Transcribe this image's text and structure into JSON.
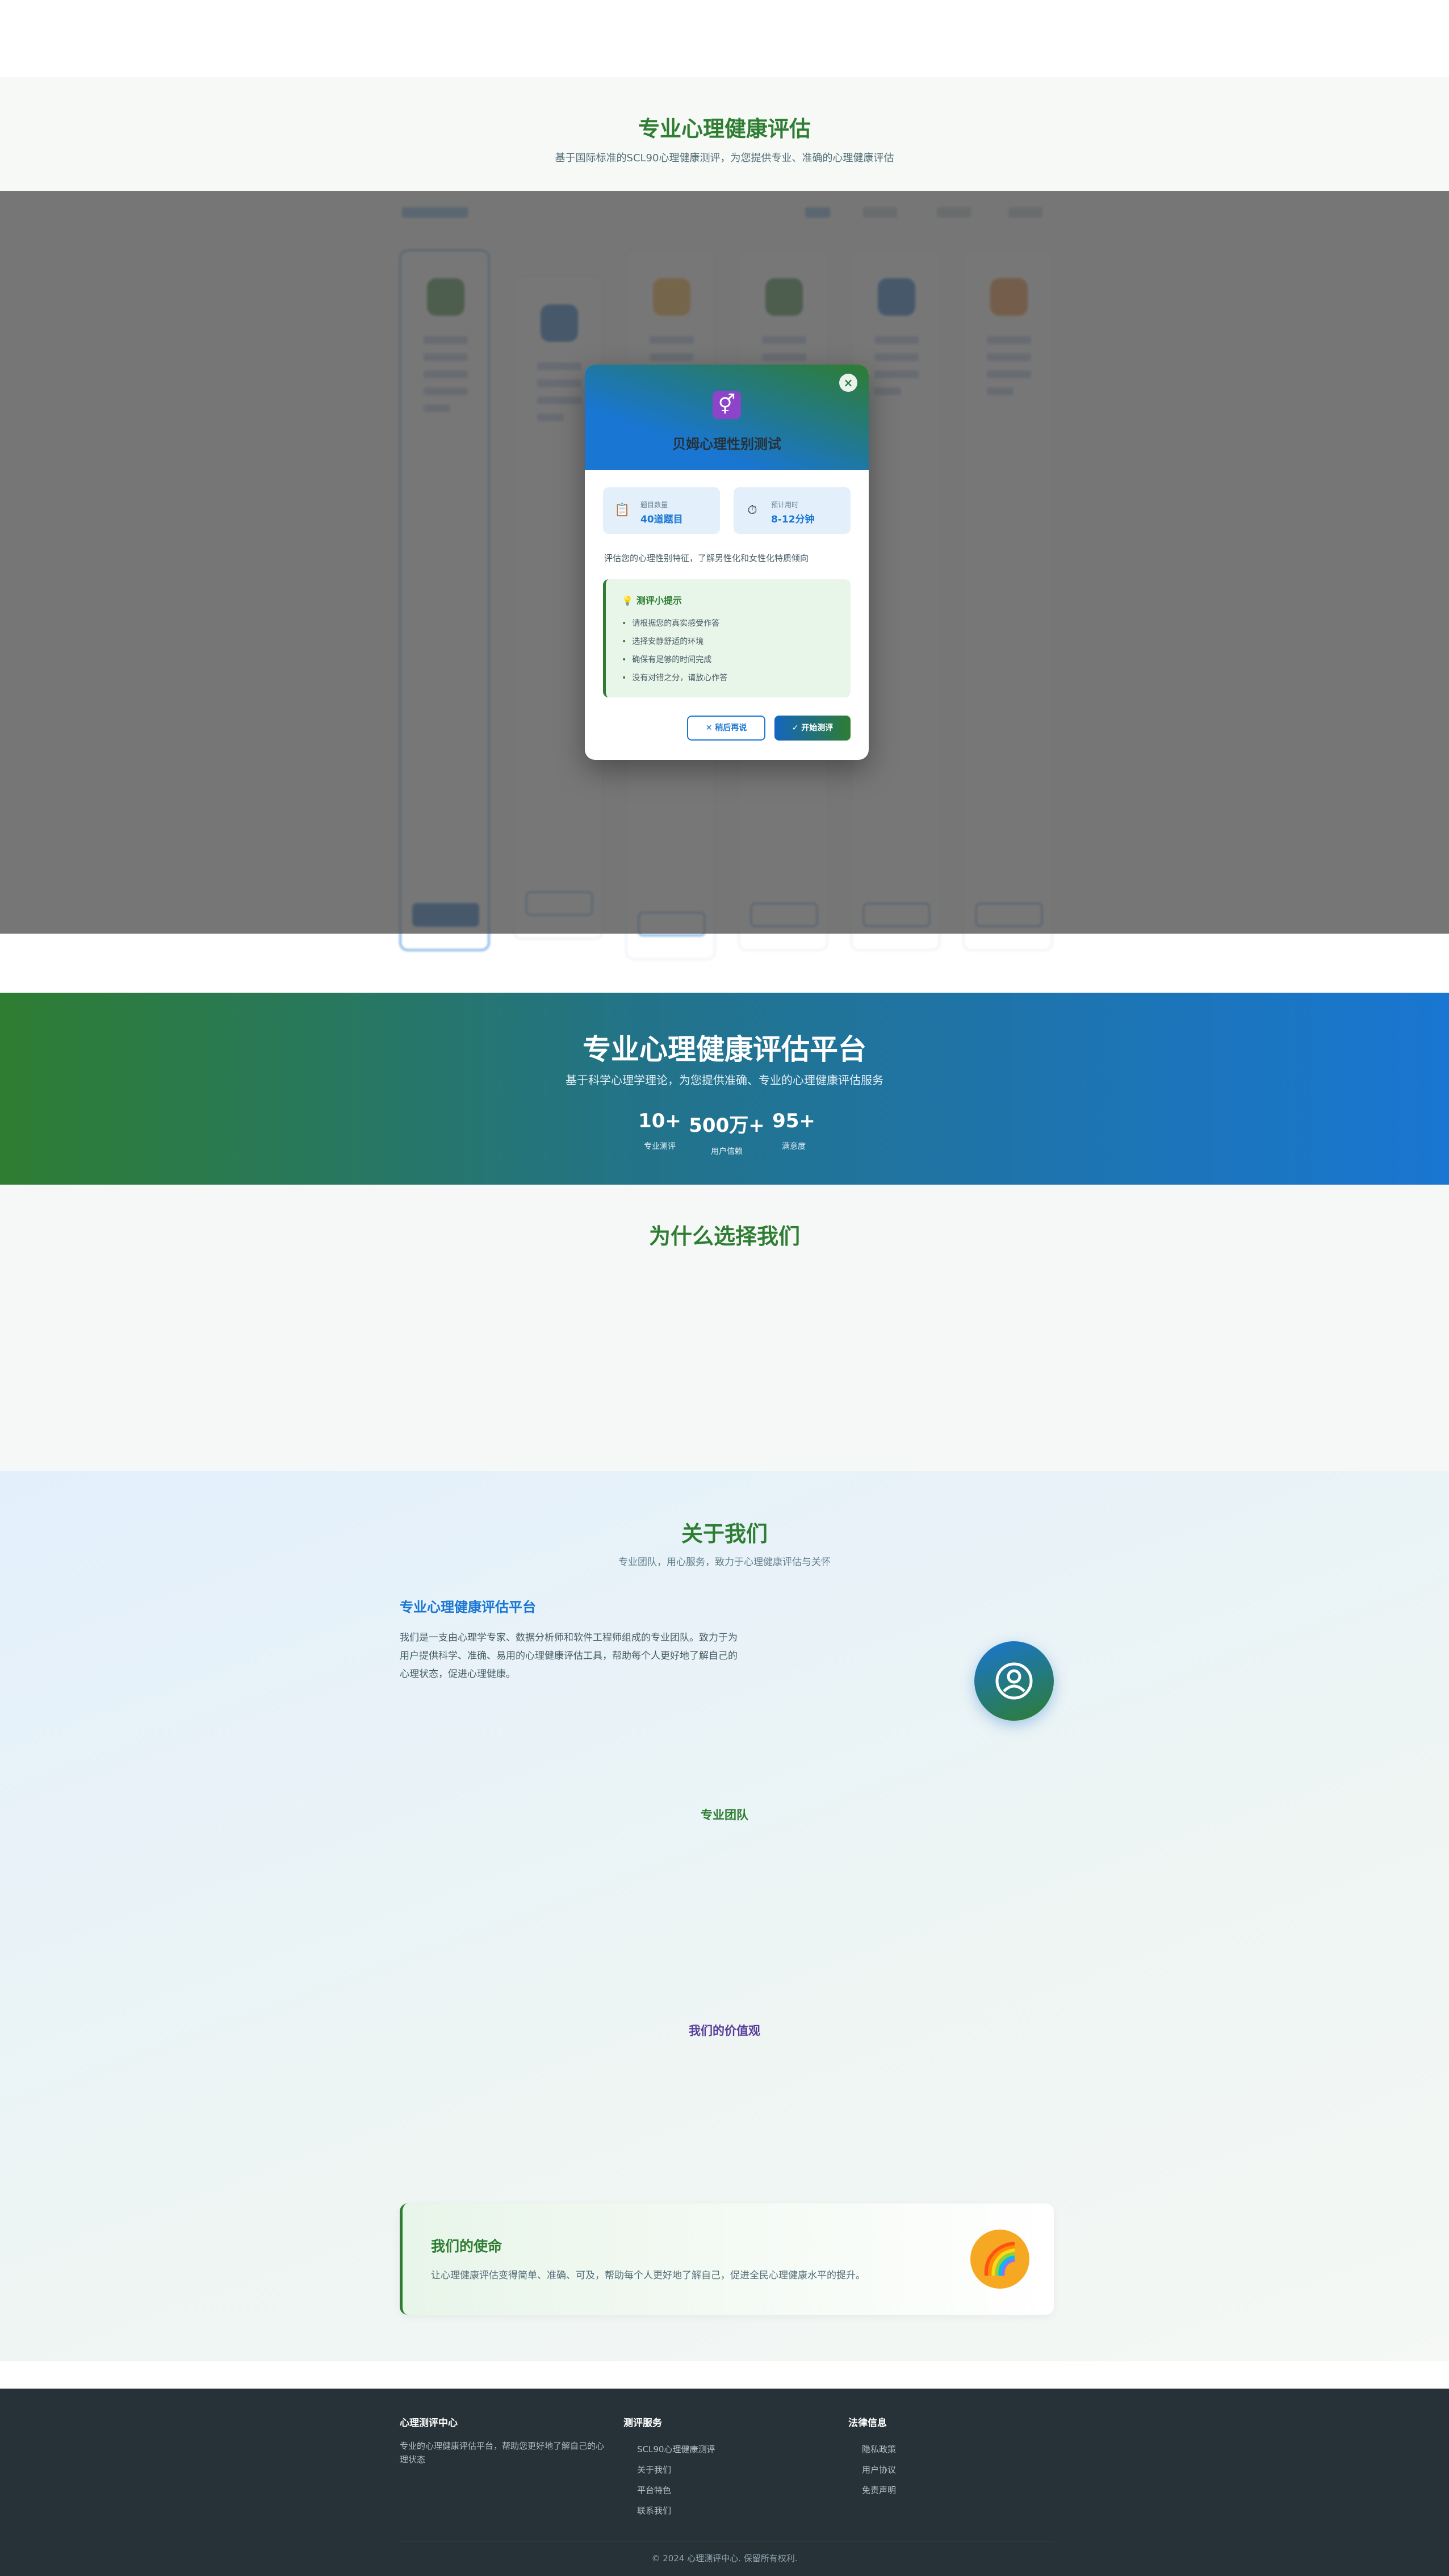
{
  "intro": {
    "title": "专业心理健康评估",
    "subtitle": "基于国际标准的SCL90心理健康测评，为您提供专业、准确的心理健康评估"
  },
  "modal": {
    "title": "贝姆心理性别测试",
    "icon": "gender-icon",
    "close_icon": "close-icon",
    "stats": [
      {
        "icon": "clipboard-icon",
        "label": "题目数量",
        "value": "40道题目"
      },
      {
        "icon": "stopwatch-icon",
        "label": "预计用时",
        "value": "8-12分钟"
      }
    ],
    "description": "评估您的心理性别特征，了解男性化和女性化特质倾向",
    "tips_title": "测评小提示",
    "tips": [
      "请根据您的真实感受作答",
      "选择安静舒适的环境",
      "确保有足够的时间完成",
      "没有对错之分，请放心作答"
    ],
    "later_label": "稍后再说",
    "start_label": "开始测评"
  },
  "platform": {
    "title": "专业心理健康评估平台",
    "subtitle": "基于科学心理学理论，为您提供准确、专业的心理健康评估服务",
    "stats": [
      {
        "value": "10+",
        "label": "专业测评"
      },
      {
        "value": "500万+",
        "label": "用户信赖"
      },
      {
        "value": "95+",
        "label": "满意度"
      }
    ]
  },
  "why": {
    "title": "为什么选择我们"
  },
  "about": {
    "title": "关于我们",
    "subtitle": "专业团队，用心服务，致力于心理健康评估与关怀",
    "heading": "专业心理健康评估平台",
    "paragraph": "我们是一支由心理学专家、数据分析师和软件工程师组成的专业团队。致力于为用户提供科学、准确、易用的心理健康评估工具，帮助每个人更好地了解自己的心理状态，促进心理健康。",
    "team_title": "专业团队",
    "values_title": "我们的价值观",
    "mission_title": "我们的使命",
    "mission_text": "让心理健康评估变得简单、准确、可及，帮助每个人更好地了解自己，促进全民心理健康水平的提升。"
  },
  "footer": {
    "col1_title": "心理测评中心",
    "col1_text": "专业的心理健康评估平台，帮助您更好地了解自己的心理状态",
    "col2_title": "测评服务",
    "col2_links": [
      "SCL90心理健康测评",
      "关于我们",
      "平台特色",
      "联系我们"
    ],
    "col3_title": "法律信息",
    "col3_links": [
      "隐私政策",
      "用户协议",
      "免责声明"
    ],
    "copyright": "© 2024 心理测评中心. 保留所有权利."
  },
  "colors": {
    "primary_green": "#2e7d32",
    "primary_blue": "#1976d2",
    "footer_bg": "#263238",
    "overlay": "rgba(85,85,85,0.80)"
  }
}
